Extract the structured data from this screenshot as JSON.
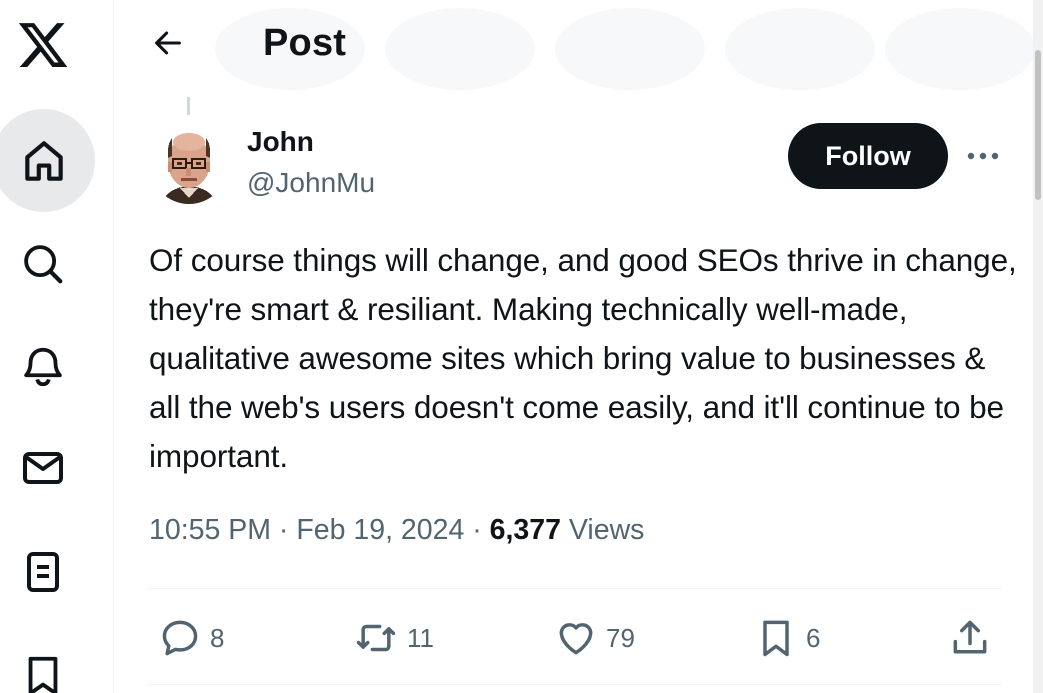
{
  "nav": {
    "logo_icon": "x-logo-icon",
    "items": [
      {
        "name": "home",
        "icon": "home-icon",
        "active": true
      },
      {
        "name": "explore",
        "icon": "search-icon"
      },
      {
        "name": "notifications",
        "icon": "bell-icon"
      },
      {
        "name": "messages",
        "icon": "envelope-icon"
      },
      {
        "name": "lists",
        "icon": "list-icon"
      },
      {
        "name": "bookmarks",
        "icon": "bookmark-icon"
      }
    ]
  },
  "header": {
    "back_icon": "arrow-left-icon",
    "title": "Post"
  },
  "post": {
    "author": {
      "name": "John",
      "handle": "@JohnMu"
    },
    "follow_label": "Follow",
    "more_icon": "ellipsis-icon",
    "text": "Of course things will change, and good SEOs thrive in change, they're smart & resiliant. Making technically well-made, qualitative awesome sites which bring value to businesses & all the web's users doesn't come easily, and it'll continue to be important.",
    "time": "10:55 PM",
    "separator": "·",
    "date": "Feb 19, 2024",
    "views_count": "6,377",
    "views_label": "Views",
    "actions": {
      "replies": "8",
      "reposts": "11",
      "likes": "79",
      "bookmarks": "6"
    }
  },
  "colors": {
    "text_primary": "#0f1419",
    "text_secondary": "#536471",
    "active_nav_bg": "#e7e9ea",
    "divider": "#eff3f4"
  }
}
